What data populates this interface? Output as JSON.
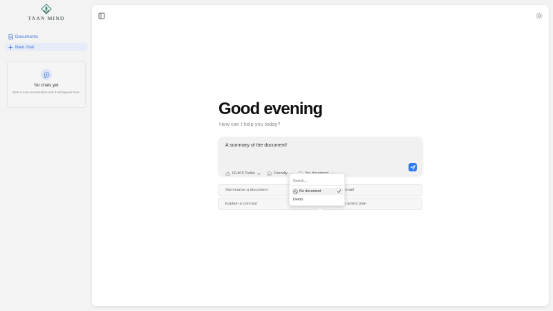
{
  "brand": {
    "name": "TAAN MIND"
  },
  "sidebar": {
    "items": [
      {
        "label": "Documents",
        "icon": "document-icon"
      },
      {
        "label": "New chat",
        "icon": "plus-icon"
      }
    ],
    "empty_state": {
      "title": "No chats yet",
      "subtitle": "Start a new conversation and it will appear here."
    }
  },
  "main": {
    "greeting": "Good evening",
    "subgreeting": "How can I help you today?",
    "composer": {
      "value": "A summary of the document!",
      "model_label": "GLM 5 Turbo",
      "tone_label": "Friendly",
      "document_label": "No document"
    },
    "suggestions": [
      {
        "label": "Summarize a document"
      },
      {
        "label": "Write an email"
      },
      {
        "label": "Explain a concept"
      },
      {
        "label": "Create an action plan"
      }
    ],
    "document_dropdown": {
      "search_placeholder": "Search...",
      "options": [
        {
          "label": "No document",
          "selected": true
        },
        {
          "label": "Demo"
        }
      ]
    }
  },
  "colors": {
    "accent": "#2f7bf5",
    "link": "#3b6fd8",
    "selected_nav_bg": "#e6ecf8",
    "logo_green": "#3a8a7a"
  }
}
